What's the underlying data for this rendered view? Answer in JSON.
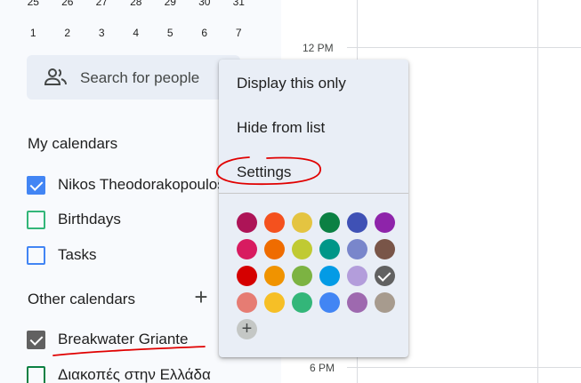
{
  "mini_calendar": {
    "row1": [
      "25",
      "26",
      "27",
      "28",
      "29",
      "30",
      "31"
    ],
    "row2": [
      "1",
      "2",
      "3",
      "4",
      "5",
      "6",
      "7"
    ]
  },
  "search": {
    "label": "Search for people",
    "icon": "people-icon"
  },
  "my_calendars": {
    "title": "My calendars",
    "items": [
      {
        "name": "Nikos Theodorakopoulos",
        "checked": true,
        "color": "#4285f4"
      },
      {
        "name": "Birthdays",
        "checked": false,
        "color": "#33b679"
      },
      {
        "name": "Tasks",
        "checked": false,
        "color": "#4285f4"
      }
    ]
  },
  "other_calendars": {
    "title": "Other calendars",
    "add_icon": "plus-icon",
    "items": [
      {
        "name": "Breakwater Griante",
        "checked": true,
        "color": "#616161"
      },
      {
        "name": "Διακοπές στην Ελλάδα",
        "checked": false,
        "color": "#0b8043"
      }
    ]
  },
  "time_labels": {
    "noon": "12 PM",
    "six": "6 PM"
  },
  "context_menu": {
    "display_only": "Display this only",
    "hide": "Hide from list",
    "settings": "Settings",
    "colors": [
      [
        "#ad1457",
        "#f4511e",
        "#e4c441",
        "#0b8043",
        "#3f51b5",
        "#8e24aa"
      ],
      [
        "#d81b60",
        "#ef6c00",
        "#c0ca33",
        "#009688",
        "#7986cb",
        "#795548"
      ],
      [
        "#d50000",
        "#f09300",
        "#7cb342",
        "#039be5",
        "#b39ddb",
        "#616161"
      ],
      [
        "#e67c73",
        "#f6bf26",
        "#33b679",
        "#4285f4",
        "#9e69af",
        "#a79b8e"
      ]
    ],
    "selected_color": "#616161",
    "add_color_icon": "plus-icon"
  },
  "annotation_color": "#e00000"
}
